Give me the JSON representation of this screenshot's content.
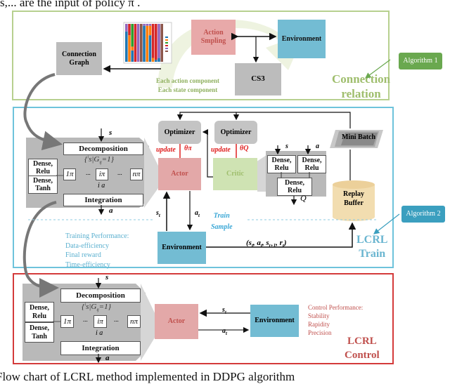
{
  "header_fragment": "s,...  are the input of policy  π .",
  "caption_fragment": "Flow chart of LCRL method implemented in DDPG algorithm",
  "colors": {
    "connection_frame": "#a9c97a",
    "train_frame": "#5bbcd6",
    "control_frame": "#d43b3b",
    "actor": "#e3a3a3",
    "critic": "#c9dfa9",
    "environment": "#73bcd3",
    "gray_box": "#b8b8b8",
    "algorithm_1": "#6aa84f",
    "algorithm_2": "#3b9fbf",
    "replay_buffer": "#f2ddb0",
    "update_red": "#e02020"
  },
  "connection_section": {
    "title_line1": "Connection",
    "title_line2": "relation",
    "action_sampling": "Action\nSmpling",
    "environment": "Environment",
    "cs3": "CS3",
    "connection_graph": "Connection\nGraph",
    "component_note_1": "Each action component",
    "component_note_2": "Each state component",
    "algorithm_badge": "Algorithm 1"
  },
  "train_section": {
    "title_line1": "LCRL",
    "title_line2": "Train",
    "algorithm_badge": "Algorithm 2",
    "policy_block": {
      "input": "s",
      "output": "a",
      "decomposition": "Decomposition",
      "subset": "{ i s | G ij =1}",
      "pi_first": "1π",
      "pi_mid": "iπ",
      "pi_last": "nπ",
      "dots": "...",
      "sub_action": "i a",
      "integration": "Integration",
      "dense_relu": "Dense,\nRelu",
      "dense_tanh": "Dense,\nTanh"
    },
    "optimizer_actor": "Optimizer",
    "optimizer_critic": "Optimizer",
    "update_actor": "update",
    "theta_actor": "θπ",
    "update_critic": "update",
    "theta_critic": "θQ",
    "actor": "Actor",
    "critic": "Critic",
    "critic_block": {
      "input_s": "s",
      "input_a": "a",
      "dense_relu_1": "Dense,\nRelu",
      "dense_relu_2": "Dense,\nRelu",
      "dense_relu_3": "Dense,\nRelu",
      "output": "Q"
    },
    "mini_batch": "Mini Batch",
    "replay_buffer": "Replay\nBuffer",
    "environment": "Environment",
    "state_label": "st",
    "action_label": "at",
    "train_sample_1": "Train",
    "train_sample_2": "Sample",
    "transition": "(st, at, st+1, rt)",
    "performance_title": "Training Performance:",
    "performance_items": [
      "Data-efficiency",
      "Final reward",
      "Time-efficiency"
    ]
  },
  "control_section": {
    "title_line1": "LCRL",
    "title_line2": "Control",
    "policy_block": {
      "input": "s",
      "output": "a",
      "decomposition": "Decomposition",
      "subset": "{ i s | G ij =1}",
      "pi_first": "1π",
      "pi_mid": "iπ",
      "pi_last": "nπ",
      "dots": "...",
      "sub_action": "i a",
      "integration": "Integration",
      "dense_relu": "Dense,\nRelu",
      "dense_tanh": "Dense,\nTanh"
    },
    "actor": "Actor",
    "environment": "Environment",
    "state_label": "st",
    "action_label": "at",
    "performance_title": "Control Performance:",
    "performance_items": [
      "Stability",
      "Rapidity",
      "Precision"
    ]
  },
  "thumbnail_chart": {
    "type": "bar",
    "stacked": true,
    "bar_count": 13,
    "legend_entries": 6,
    "series_colors": [
      "#1f77b4",
      "#ff7f0e",
      "#2ca02c",
      "#d62728",
      "#9467bd",
      "#8c564b"
    ]
  }
}
